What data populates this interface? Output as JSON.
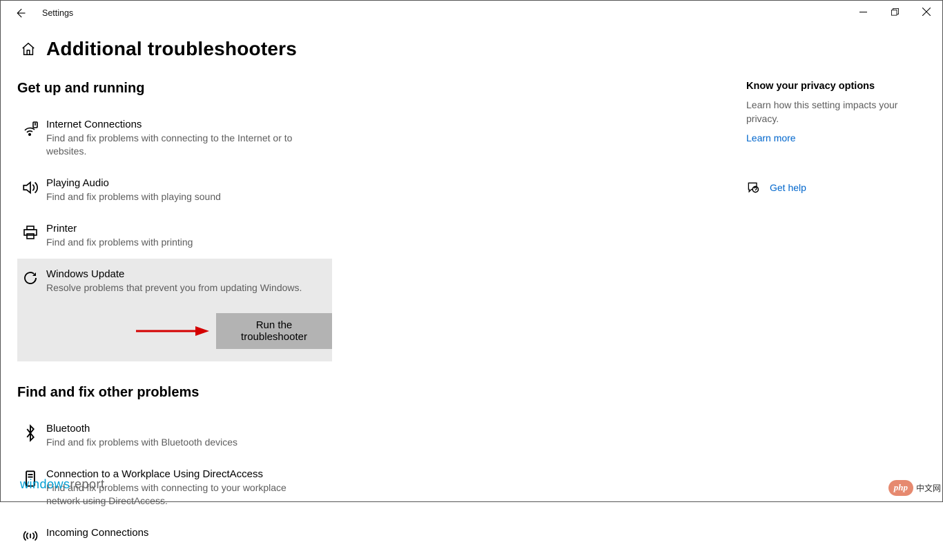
{
  "window": {
    "app_title": "Settings"
  },
  "page": {
    "title": "Additional troubleshooters"
  },
  "section1": {
    "title": "Get up and running",
    "items": [
      {
        "title": "Internet Connections",
        "desc": "Find and fix problems with connecting to the Internet or to websites."
      },
      {
        "title": "Playing Audio",
        "desc": "Find and fix problems with playing sound"
      },
      {
        "title": "Printer",
        "desc": "Find and fix problems with printing"
      },
      {
        "title": "Windows Update",
        "desc": "Resolve problems that prevent you from updating Windows."
      }
    ],
    "run_button": "Run the troubleshooter"
  },
  "section2": {
    "title": "Find and fix other problems",
    "items": [
      {
        "title": "Bluetooth",
        "desc": "Find and fix problems with Bluetooth devices"
      },
      {
        "title": "Connection to a Workplace Using DirectAccess",
        "desc": "Find and fix problems with connecting to your workplace network using DirectAccess."
      },
      {
        "title": "Incoming Connections",
        "desc": ""
      }
    ]
  },
  "sidebar": {
    "privacy_title": "Know your privacy options",
    "privacy_desc": "Learn how this setting impacts your privacy.",
    "learn_more": "Learn more",
    "get_help": "Get help"
  },
  "watermarks": {
    "wr_blue": "windows",
    "wr_gray": "report",
    "php_badge": "php",
    "cn_text": "中文网"
  }
}
